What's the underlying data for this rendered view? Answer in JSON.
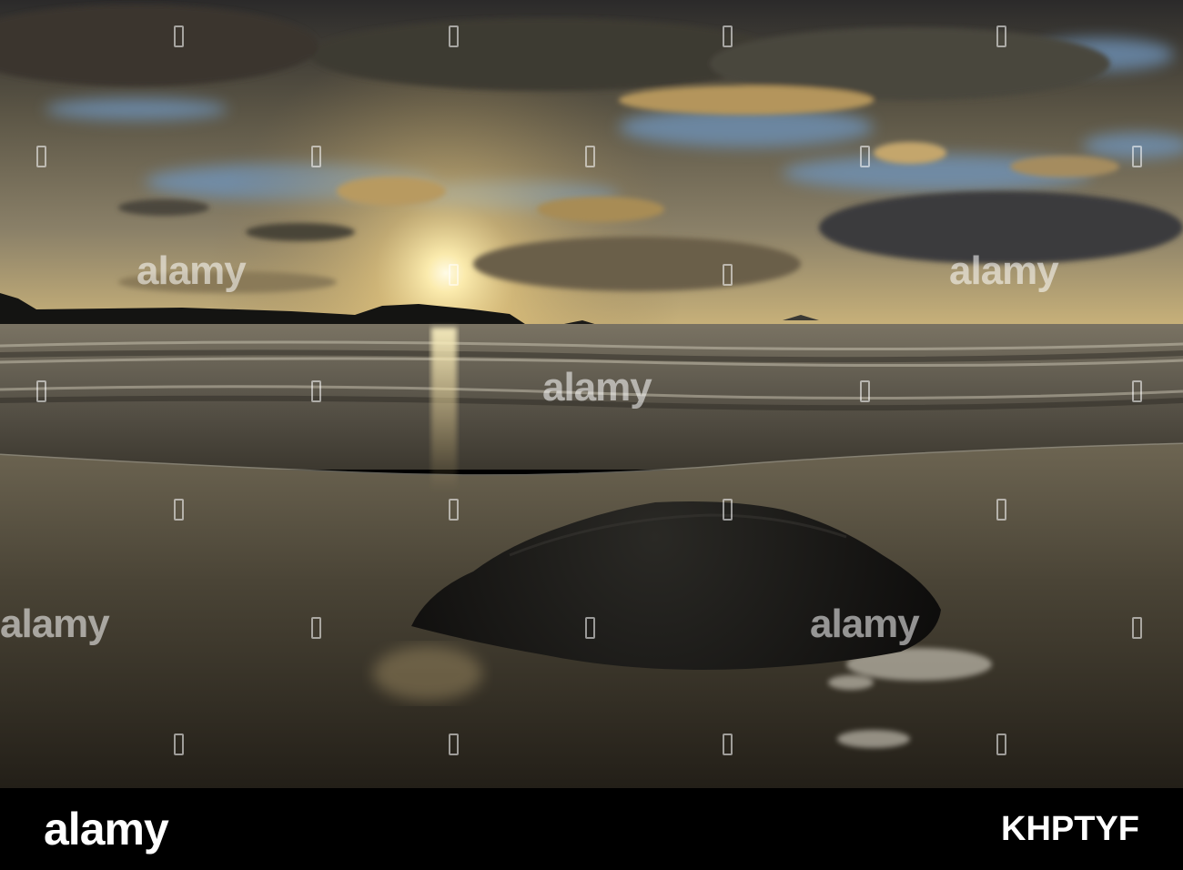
{
  "photo": {
    "subject": "sunset-over-beach-with-rock",
    "colors": {
      "sky_dark": "#2a2a2c",
      "sky_blue": "#6f95bd",
      "sun_glow": "#fff4c8",
      "cloud_gold": "#b7965a",
      "headland": "#141412",
      "sea": "#5f5a50",
      "sand": "#3a352c",
      "rock": "#151413"
    }
  },
  "watermark": {
    "text": "alamy"
  },
  "footer": {
    "logo": "alamy",
    "image_id": "KHPTYF",
    "background": "#000000",
    "text_color": "#ffffff"
  }
}
